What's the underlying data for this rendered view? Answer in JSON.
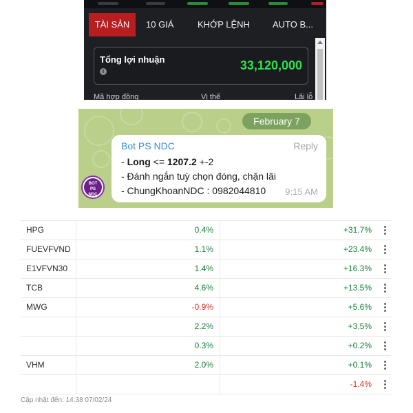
{
  "app": {
    "tabs": [
      {
        "label": "TÀI SẢN",
        "active": true
      },
      {
        "label": "10 GIÁ",
        "active": false
      },
      {
        "label": "KHỚP LỆNH",
        "active": false
      },
      {
        "label": "AUTO B...",
        "active": false
      }
    ],
    "profit_label": "Tổng lợi nhuận",
    "profit_value": "33,120,000",
    "columns": [
      "Mã hợp đồng",
      "Vị thế",
      "Lãi lỗ"
    ],
    "colors": {
      "active_tab": "#b81d20",
      "profit": "#2ee14a",
      "background": "#1e1f23"
    }
  },
  "chat": {
    "date": "February 7",
    "avatar_text": "BOT PS NDC",
    "sender": "Bot PS NDC",
    "reply_label": "Reply",
    "line1_prefix": "- ",
    "line1_bold1": "Long",
    "line1_mid": " <= ",
    "line1_bold2": "1207.2",
    "line1_suffix": " +-2",
    "line2": " - Đánh ngắn tuỳ chọn đóng, chặn lãi",
    "line3": " - ChungKhoanNDC : 0982044810",
    "time": "9:15 AM"
  },
  "watchlist": {
    "rows": [
      {
        "symbol": "HPG",
        "day": "0.4%",
        "day_dir": "up",
        "total": "+31.7%",
        "total_dir": "up"
      },
      {
        "symbol": "FUEVFVND",
        "day": "1.1%",
        "day_dir": "up",
        "total": "+23.4%",
        "total_dir": "up"
      },
      {
        "symbol": "E1VFVN30",
        "day": "1.4%",
        "day_dir": "up",
        "total": "+16.3%",
        "total_dir": "up"
      },
      {
        "symbol": "TCB",
        "day": "4.6%",
        "day_dir": "up",
        "total": "+13.5%",
        "total_dir": "up"
      },
      {
        "symbol": "MWG",
        "day": "-0.9%",
        "day_dir": "down",
        "total": "+5.6%",
        "total_dir": "up"
      },
      {
        "symbol": "",
        "day": "2.2%",
        "day_dir": "up",
        "total": "+3.5%",
        "total_dir": "up"
      },
      {
        "symbol": "",
        "day": "0.3%",
        "day_dir": "up",
        "total": "+0.2%",
        "total_dir": "up"
      },
      {
        "symbol": "VHM",
        "day": "2.0%",
        "day_dir": "up",
        "total": "+0.1%",
        "total_dir": "up"
      },
      {
        "symbol": "",
        "day": "",
        "day_dir": "up",
        "total": "-1.4%",
        "total_dir": "down"
      }
    ],
    "updated": "Cập nhật đến: 14:38 07/02/24",
    "colors": {
      "up": "#188038",
      "down": "#d93025"
    }
  }
}
